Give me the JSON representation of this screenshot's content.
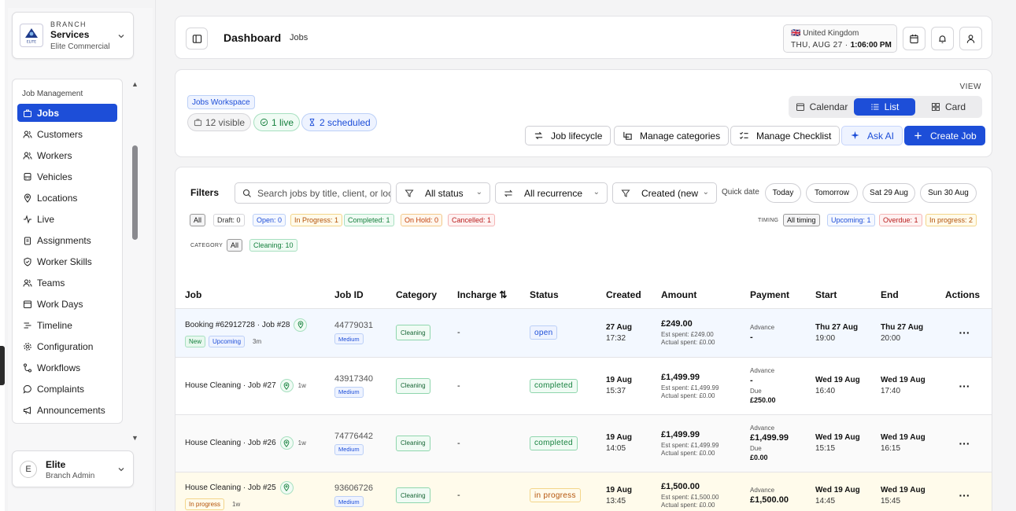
{
  "sidebar": {
    "branch_label": "BRANCH",
    "branch_name": "Services",
    "branch_sub": "Elite Commercial",
    "logo_text": "ELITE",
    "section": "Job Management",
    "items": [
      {
        "label": "Jobs",
        "icon": "briefcase-icon"
      },
      {
        "label": "Customers",
        "icon": "users-icon"
      },
      {
        "label": "Workers",
        "icon": "users-icon"
      },
      {
        "label": "Vehicles",
        "icon": "bus-icon"
      },
      {
        "label": "Locations",
        "icon": "map-pin-icon"
      },
      {
        "label": "Live",
        "icon": "activity-icon"
      },
      {
        "label": "Assignments",
        "icon": "clipboard-icon"
      },
      {
        "label": "Worker Skills",
        "icon": "shield-icon"
      },
      {
        "label": "Teams",
        "icon": "users-icon"
      },
      {
        "label": "Work Days",
        "icon": "calendar-icon"
      },
      {
        "label": "Timeline",
        "icon": "timeline-icon"
      },
      {
        "label": "Configuration",
        "icon": "gear-icon"
      },
      {
        "label": "Workflows",
        "icon": "workflow-icon"
      },
      {
        "label": "Complaints",
        "icon": "message-icon"
      },
      {
        "label": "Announcements",
        "icon": "megaphone-icon"
      }
    ],
    "user": {
      "initial": "E",
      "name": "Elite",
      "role": "Branch Admin"
    }
  },
  "topbar": {
    "title": "Dashboard",
    "crumb": "Jobs",
    "country": "🇬🇧 United Kingdom",
    "date": "THU, AUG 27 ·",
    "time": "1:06:00 PM"
  },
  "workspace": {
    "badge": "Jobs Workspace",
    "visible": "12 visible",
    "live": "1 live",
    "scheduled": "2 scheduled",
    "view_label": "VIEW",
    "views": [
      "Calendar",
      "List",
      "Card"
    ],
    "active_view": "List",
    "actions": [
      "Job lifecycle",
      "Manage categories",
      "Manage Checklist",
      "Ask AI",
      "Create Job"
    ]
  },
  "filters": {
    "label": "Filters",
    "search_placeholder": "Search jobs by title, client, or location",
    "status": "All status",
    "recurrence": "All recurrence",
    "sort": "Created (newest)",
    "quick_date_label": "Quick date",
    "quick_dates": [
      "Today",
      "Tomorrow",
      "Sat 29 Aug",
      "Sun 30 Aug"
    ],
    "status_chips": [
      "All",
      "Draft: 0",
      "Open: 0",
      "In Progress: 1",
      "Completed: 1",
      "On Hold: 0",
      "Cancelled: 1"
    ],
    "timing_label": "TIMING",
    "timing_chips": [
      "All timing",
      "Upcoming: 1",
      "Overdue: 1",
      "In progress: 2"
    ],
    "category_label": "CATEGORY",
    "category_chips": [
      "All",
      "Cleaning: 10"
    ]
  },
  "table": {
    "headers": [
      "Job",
      "Job ID",
      "Category",
      "Incharge ⇅",
      "Status",
      "Created",
      "Amount",
      "Payment",
      "Start",
      "End",
      "Actions"
    ],
    "rows": [
      {
        "job": "Booking #62912728 · Job #28",
        "tags": [
          "New",
          "Upcoming"
        ],
        "age": "3m",
        "id": "44779031",
        "priority": "Medium",
        "category": "Cleaning",
        "incharge": "-",
        "status": "open",
        "created_date": "27 Aug",
        "created_time": "17:32",
        "amount": "£249.00",
        "est": "Est spent: £249.00",
        "actual": "Actual spent: £0.00",
        "pay_label": "Advance",
        "pay_value": "-",
        "due_label": "",
        "due_value": "",
        "start_day": "Thu 27 Aug",
        "start_time": "19:00",
        "end_day": "Thu 27 Aug",
        "end_time": "20:00",
        "actions": "···"
      },
      {
        "job": "House Cleaning · Job #27",
        "tags": [],
        "age": "1w",
        "id": "43917340",
        "priority": "Medium",
        "category": "Cleaning",
        "incharge": "-",
        "status": "completed",
        "created_date": "19 Aug",
        "created_time": "15:37",
        "amount": "£1,499.99",
        "est": "Est spent: £1,499.99",
        "actual": "Actual spent: £0.00",
        "pay_label": "Advance",
        "pay_value": "-",
        "due_label": "Due",
        "due_value": "£250.00",
        "start_day": "Wed 19 Aug",
        "start_time": "16:40",
        "end_day": "Wed 19 Aug",
        "end_time": "17:40",
        "actions": "···"
      },
      {
        "job": "House Cleaning · Job #26",
        "tags": [],
        "age": "1w",
        "id": "74776442",
        "priority": "Medium",
        "category": "Cleaning",
        "incharge": "-",
        "status": "completed",
        "created_date": "19 Aug",
        "created_time": "14:05",
        "amount": "£1,499.99",
        "est": "Est spent: £1,499.99",
        "actual": "Actual spent: £0.00",
        "pay_label": "Advance",
        "pay_value": "£1,499.99",
        "due_label": "Due",
        "due_value": "£0.00",
        "start_day": "Wed 19 Aug",
        "start_time": "15:15",
        "end_day": "Wed 19 Aug",
        "end_time": "16:15",
        "actions": "···"
      },
      {
        "job": "House Cleaning · Job #25",
        "tags": [
          "In progress"
        ],
        "age": "1w",
        "id": "93606726",
        "priority": "Medium",
        "category": "Cleaning",
        "incharge": "-",
        "status": "in progress",
        "created_date": "19 Aug",
        "created_time": "13:45",
        "amount": "£1,500.00",
        "est": "Est spent: £1,500.00",
        "actual": "Actual spent: £0.00",
        "pay_label": "Advance",
        "pay_value": "£1,500.00",
        "due_label": "",
        "due_value": "",
        "start_day": "Wed 19 Aug",
        "start_time": "14:45",
        "end_day": "Wed 19 Aug",
        "end_time": "15:45",
        "actions": "···"
      }
    ]
  },
  "colors": {
    "accent": "#1d4ed8",
    "open": "#1d4ed8",
    "completed": "#15803d",
    "in_progress": "#b45309"
  }
}
